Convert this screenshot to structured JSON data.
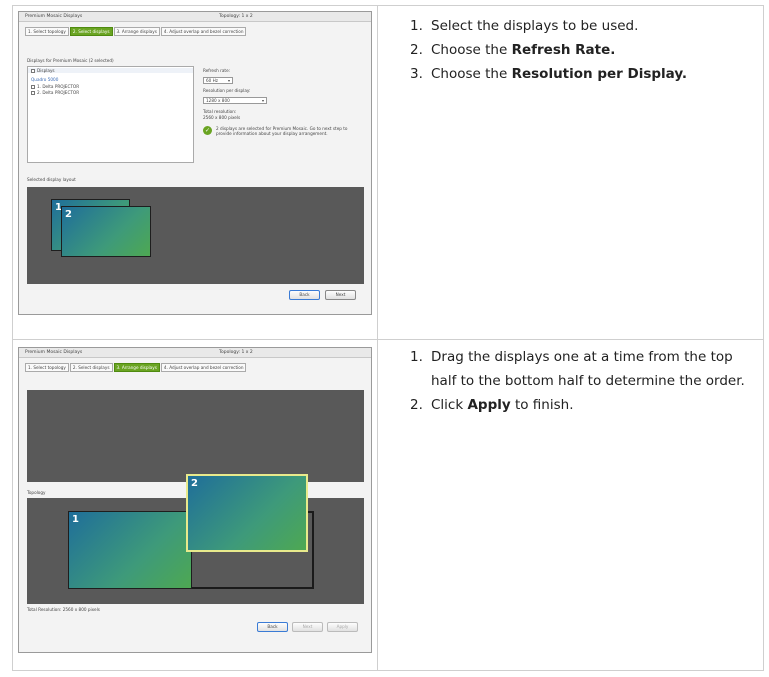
{
  "screenshot1": {
    "window_title": "Premium Mosaic Displays",
    "topology": "Topology: 1 x 2",
    "tabs": [
      "1. Select topology",
      "2. Select displays",
      "3. Arrange displays",
      "4. Adjust overlap and bezel correction"
    ],
    "active_tab": 1,
    "displays_list_title": "Displays for Premium Mosaic (2 selected)",
    "list_header": "Displays",
    "list_group": "Quadro 5000",
    "list_items": [
      "1. Delta PROJECTOR",
      "2. Delta PROJECTOR"
    ],
    "refresh_rate_label": "Refresh rate:",
    "refresh_rate_value": "60 Hz",
    "resolution_label": "Resolution per display:",
    "resolution_value": "1280 x 800",
    "total_resolution_label": "Total resolution:",
    "total_resolution_value": "2560 x 800 pixels",
    "info_message": "2 displays are selected for Premium Mosaic. Go to next step to provide information about your display arrangement.",
    "selected_layout_label": "Selected display layout",
    "display_labels": [
      "1",
      "2"
    ],
    "back_button": "Back",
    "next_button": "Next"
  },
  "screenshot2": {
    "window_title": "Premium Mosaic Displays",
    "topology": "Topology: 1 x 2",
    "tabs": [
      "1. Select topology",
      "2. Select displays",
      "3. Arrange displays",
      "4. Adjust overlap and bezel correction"
    ],
    "active_tab": 2,
    "topology_label": "Topology",
    "display_labels": [
      "2",
      "1"
    ],
    "total_resolution": "Total Resolution: 2560 x 800 pixels",
    "back_button": "Back",
    "next_button": "Next",
    "apply_button": "Apply"
  },
  "instructions1": [
    {
      "num": "1.",
      "text": "Select the displays to be used.",
      "bold": ""
    },
    {
      "num": "2.",
      "text": "Choose the ",
      "bold": "Refresh Rate."
    },
    {
      "num": "3.",
      "text": "Choose the ",
      "bold": "Resolution per Display."
    }
  ],
  "instructions2": [
    {
      "num": "1.",
      "text": "Drag the displays one at a time from the top half to the bottom half to determine the order.",
      "bold": ""
    },
    {
      "num": "2.",
      "text": "Click ",
      "bold": "Apply",
      "after": " to finish."
    }
  ],
  "colors": {
    "active_tab": "#6aa422",
    "arrange_bg": "#595959",
    "border": "#cfcfcf",
    "highlight": "#e8ea8c"
  }
}
